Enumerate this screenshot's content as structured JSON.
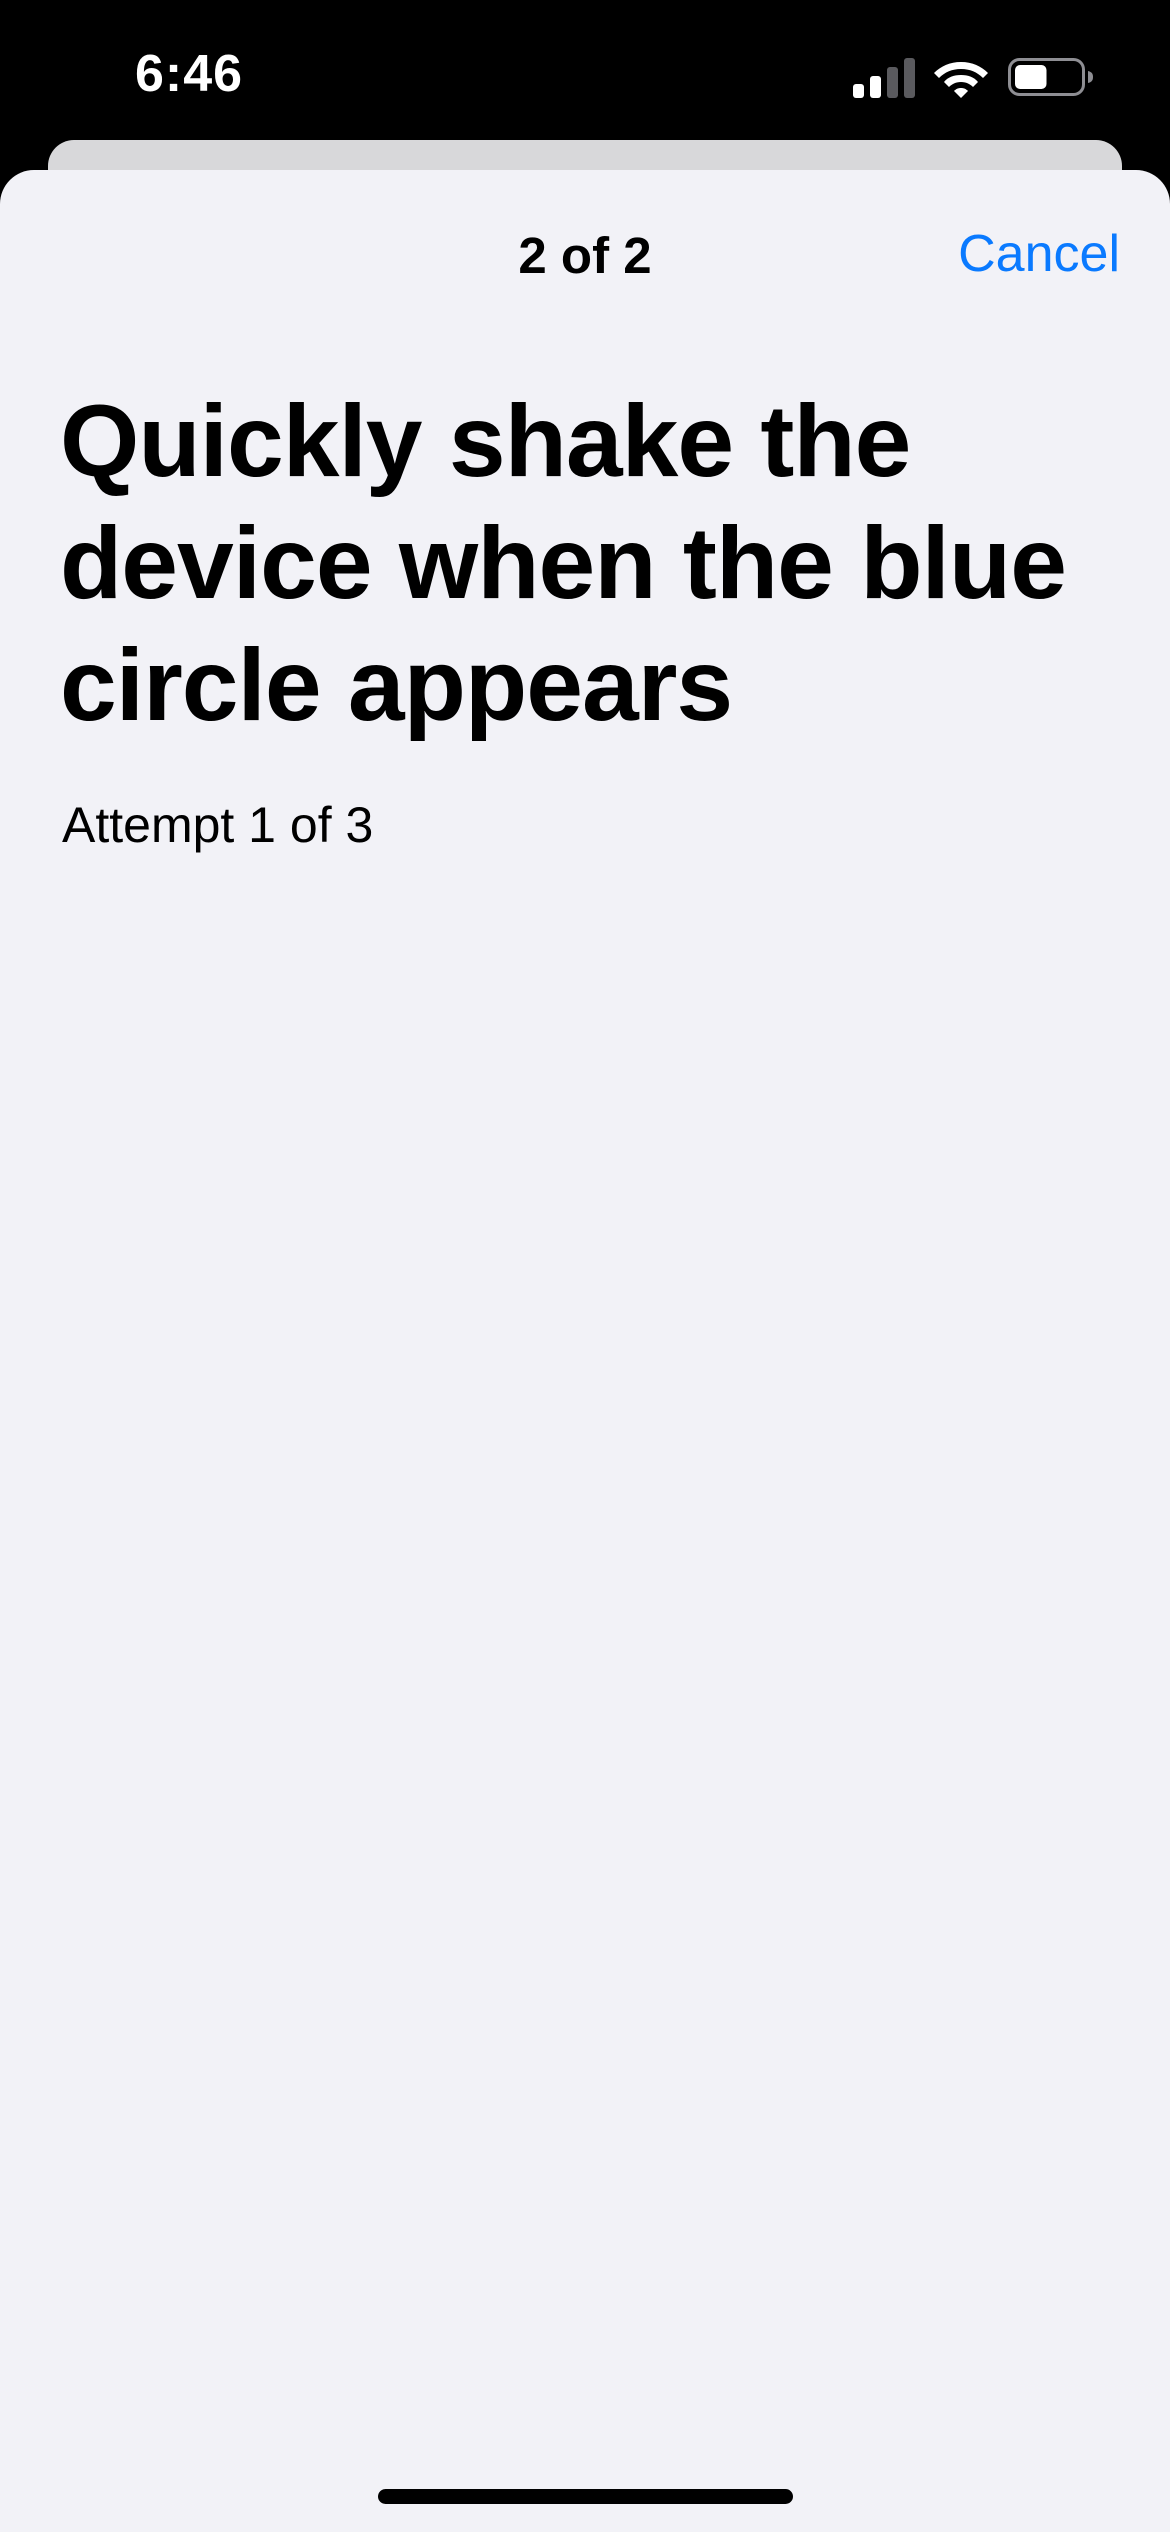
{
  "status_bar": {
    "time": "6:46",
    "signal_icon": "cellular-signal-icon",
    "wifi_icon": "wifi-icon",
    "battery_icon": "battery-icon",
    "battery_level": 0.5
  },
  "sheet": {
    "nav_title": "2 of 2",
    "cancel_label": "Cancel",
    "heading": "Quickly shake the device when the blue circle appears",
    "attempt": "Attempt 1 of 3"
  },
  "colors": {
    "accent": "#0a7aff",
    "sheet_background": "#f2f2f7",
    "status_background": "#000000"
  }
}
